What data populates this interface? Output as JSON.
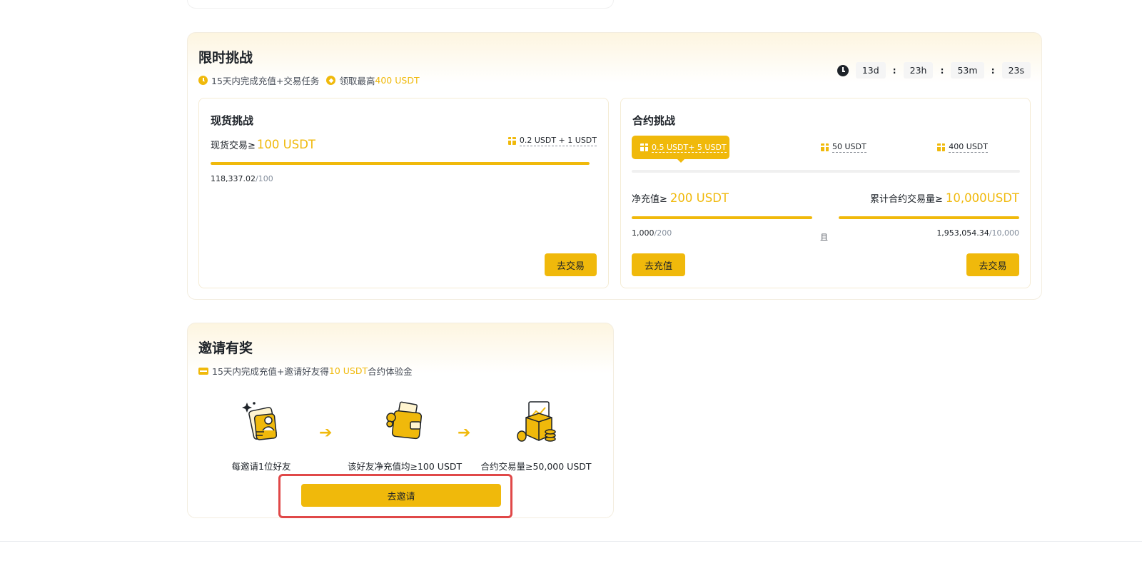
{
  "challenge": {
    "title": "限时挑战",
    "subtitle_part1": "15天内完成充值+交易任务",
    "subtitle_part2": "领取最高",
    "subtitle_highlight": "400 USDT",
    "countdown": {
      "days": "13d",
      "hours": "23h",
      "minutes": "53m",
      "seconds": "23s",
      "separator": ":"
    },
    "spot": {
      "title": "现货挑战",
      "goal_label": "现货交易≥",
      "goal_value": "100 USDT",
      "reward": "0.2 USDT + 1 USDT",
      "progress_current": "118,337.02",
      "progress_target": "/100",
      "progress_fraction": 1.0,
      "button": "去交易"
    },
    "futures": {
      "title": "合约挑战",
      "tiers": [
        "0.5 USDT+ 5 USDT",
        "50 USDT",
        "400 USDT"
      ],
      "deposit_label": "净充值≥",
      "deposit_value": "200 USDT",
      "deposit_current": "1,000",
      "deposit_target": "/200",
      "deposit_fraction": 1.0,
      "and_label": "且",
      "volume_label": "累计合约交易量≥",
      "volume_value": "10,000USDT",
      "volume_current": "1,953,054.34",
      "volume_target": "/10,000",
      "volume_fraction": 1.0,
      "deposit_button": "去充值",
      "trade_button": "去交易"
    }
  },
  "invite": {
    "title": "邀请有奖",
    "subtitle_part1": "15天内完成充值+邀请好友得",
    "subtitle_highlight": "10 USDT",
    "subtitle_part2": "合约体验金",
    "steps": [
      "每邀请1位好友",
      "该好友净充值均≥100 USDT",
      "合约交易量≥50,000 USDT"
    ],
    "button": "去邀请"
  },
  "colors": {
    "accent": "#f0b90b",
    "text": "#1e2329",
    "muted": "#848e9c",
    "highlight_border": "#e04848"
  },
  "icons": {
    "timer": "clock-icon",
    "reward": "gift-icon",
    "steps": [
      "friend-card-illustration",
      "wallet-illustration",
      "trading-box-illustration"
    ]
  }
}
